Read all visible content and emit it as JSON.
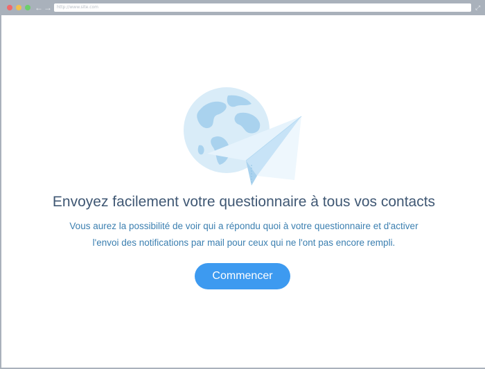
{
  "browser": {
    "url": "http://www.site.com",
    "nav_back": "←",
    "nav_forward": "→",
    "expand_glyph": "⤢"
  },
  "icons": {
    "window_controls": [
      "close-dot",
      "minimize-dot",
      "zoom-dot"
    ],
    "illustration": [
      "globe-icon",
      "paper-plane-icon"
    ]
  },
  "colors": {
    "accent": "#3d9af0",
    "headline": "#3f5773",
    "subtext": "#3b7fb0",
    "chrome": "#a9b1bb"
  },
  "main": {
    "headline": "Envoyez facilement votre questionnaire à tous vos contacts",
    "subtext_line1": "Vous aurez la possibilité de voir qui a répondu quoi à votre questionnaire et d'activer",
    "subtext_line2": "l'envoi des notifications par mail pour ceux qui ne l'ont pas encore rempli.",
    "cta_label": "Commencer"
  }
}
